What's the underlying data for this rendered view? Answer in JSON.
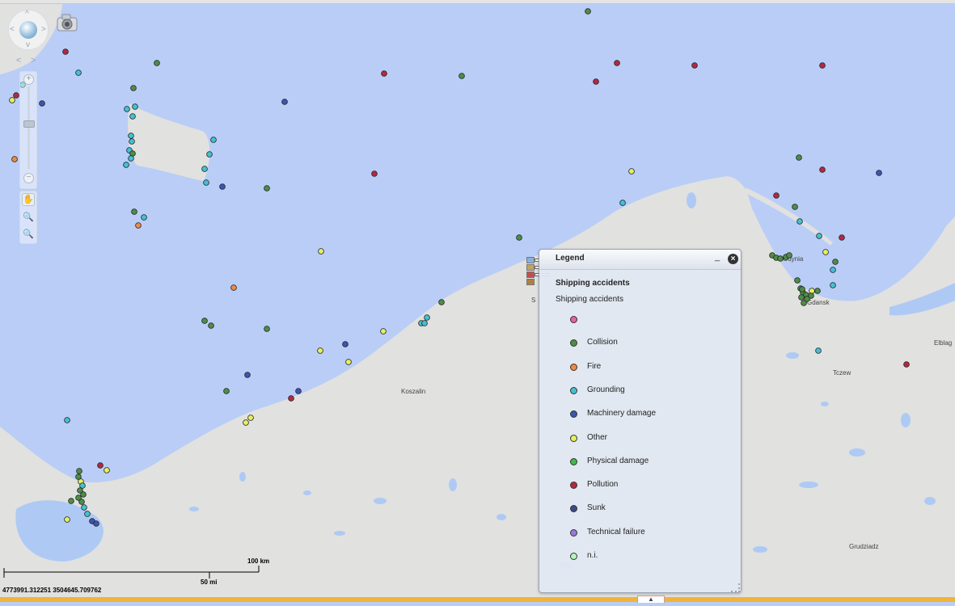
{
  "map": {
    "place_labels": {
      "koszalin": "Koszalin",
      "gdansk": "Gdansk",
      "gdynia": "Gdynia",
      "tczew": "Tczew",
      "elblag": "Elblag",
      "grudziadz": "Grudziadz",
      "slupsk": "S"
    },
    "coordinates_readout": "4773991.312251 3504645.709762",
    "scale": {
      "km_label": "100 km",
      "mi_label": "50 mi"
    },
    "colors": {
      "sea": "#b9cdf7",
      "land": "#e1e1df",
      "water_body": "#aecaf4"
    }
  },
  "legend": {
    "title": "Legend",
    "minimize_glyph": "_",
    "close_glyph": "×",
    "group_title": "Shipping accidents",
    "layer_name": "Shipping accidents",
    "items": [
      {
        "label": "",
        "color": "#e860a0"
      },
      {
        "label": "Collision",
        "color": "#4e8d48"
      },
      {
        "label": "Fire",
        "color": "#f08a40"
      },
      {
        "label": "Grounding",
        "color": "#45c0d2"
      },
      {
        "label": "Machinery damage",
        "color": "#3c55b0"
      },
      {
        "label": "Other",
        "color": "#e5ef60"
      },
      {
        "label": "Physical damage",
        "color": "#3fbb48"
      },
      {
        "label": "Pollution",
        "color": "#b52840"
      },
      {
        "label": "Sunk",
        "color": "#3c4a86"
      },
      {
        "label": "Technical failure",
        "color": "#9a7ad8"
      },
      {
        "label": "n.i.",
        "color": "#b6f6ba"
      }
    ]
  },
  "controls": {
    "pan_up": "^",
    "pan_down": "v",
    "pan_left": "<",
    "pan_right": ">",
    "zoom_in": "+",
    "zoom_out": "−",
    "history_prev": "<",
    "history_next": ">",
    "icons": [
      "pan-wheel-icon",
      "camera-icon",
      "zoom-in-icon",
      "zoom-out-icon",
      "hand-pan-icon",
      "zoom-box-in-icon",
      "zoom-box-out-icon"
    ]
  },
  "bottom_tab": "▲"
}
